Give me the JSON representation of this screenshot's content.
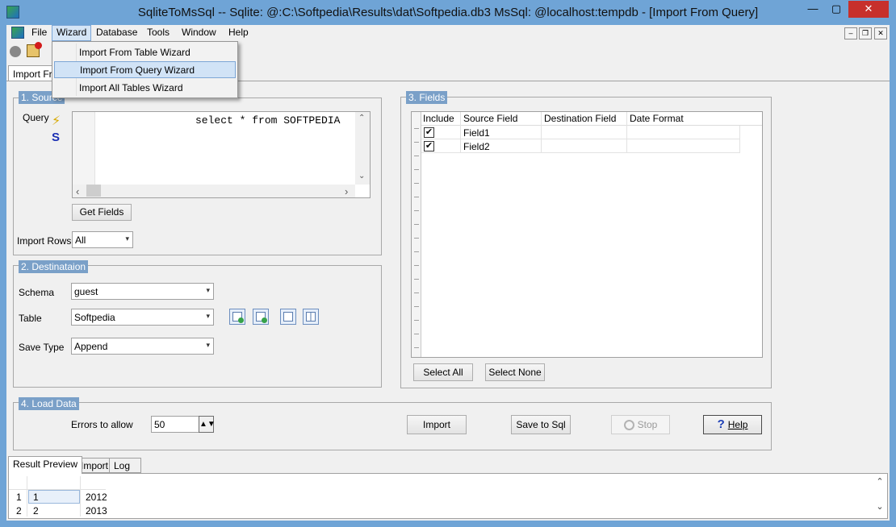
{
  "window": {
    "title": "SqliteToMsSql -- Sqlite: @:C:\\Softpedia\\Results\\dat\\Softpedia.db3 MsSql: @localhost:tempdb - [Import From Query]",
    "min_glyph": "—",
    "max_glyph": "▢",
    "close_glyph": "✕"
  },
  "menu": {
    "items": [
      "File",
      "Wizard",
      "Database",
      "Tools",
      "Window",
      "Help"
    ],
    "mdi_min": "–",
    "mdi_restore": "❐",
    "mdi_close": "✕"
  },
  "wizard_menu": {
    "items": [
      "Import From Table Wizard",
      "Import From Query Wizard",
      "Import All Tables Wizard"
    ],
    "highlighted": "Import From Query Wizard"
  },
  "document_tab": "Import From Query",
  "source": {
    "title": "1. Source",
    "query_label": "Query",
    "query_text": "select * from SOFTPEDIA",
    "run_icon": "lightning-icon",
    "sql_icon": "sql-icon",
    "run_glyph": "⚡",
    "sql_glyph": "S",
    "get_fields_label": "Get Fields",
    "import_rows_label": "Import Rows",
    "import_rows_value": "All"
  },
  "destination": {
    "title": "2. Destinataion",
    "schema_label": "Schema",
    "schema_value": "guest",
    "table_label": "Table",
    "table_value": "Softpedia",
    "save_type_label": "Save Type",
    "save_type_value": "Append"
  },
  "fields": {
    "title": "3. Fields",
    "columns": [
      "Include",
      "Source Field",
      "Destination Field",
      "Date Format"
    ],
    "rows": [
      {
        "include": true,
        "source": "Field1",
        "destination": "",
        "date_format": ""
      },
      {
        "include": true,
        "source": "Field2",
        "destination": "",
        "date_format": ""
      }
    ],
    "check_glyph": "✔",
    "select_all_label": "Select All",
    "select_none_label": "Select None"
  },
  "load": {
    "title": "4. Load Data",
    "errors_label": "Errors to allow",
    "errors_value": "50",
    "spin_glyph": "▲▼",
    "import_label": "Import",
    "save_sql_label": "Save to Sql",
    "stop_label": "Stop",
    "help_label": "Help",
    "help_glyph": "?"
  },
  "bottom_tabs": [
    "Result Preview",
    "Import",
    "Log"
  ],
  "result_preview": {
    "rows": [
      {
        "n": "1",
        "a": "1",
        "b": "2012"
      },
      {
        "n": "2",
        "a": "2",
        "b": "2013"
      }
    ]
  },
  "glyphs": {
    "chevron_down": "▾",
    "arrow_up": "⌃",
    "arrow_down": "⌄",
    "arrow_left": "‹",
    "arrow_right": "›"
  },
  "colors": {
    "title_bar": "#6fa4d6",
    "group_title": "#7aa0c8",
    "highlight": "#d1e3f6",
    "close_button": "#c7302b"
  }
}
